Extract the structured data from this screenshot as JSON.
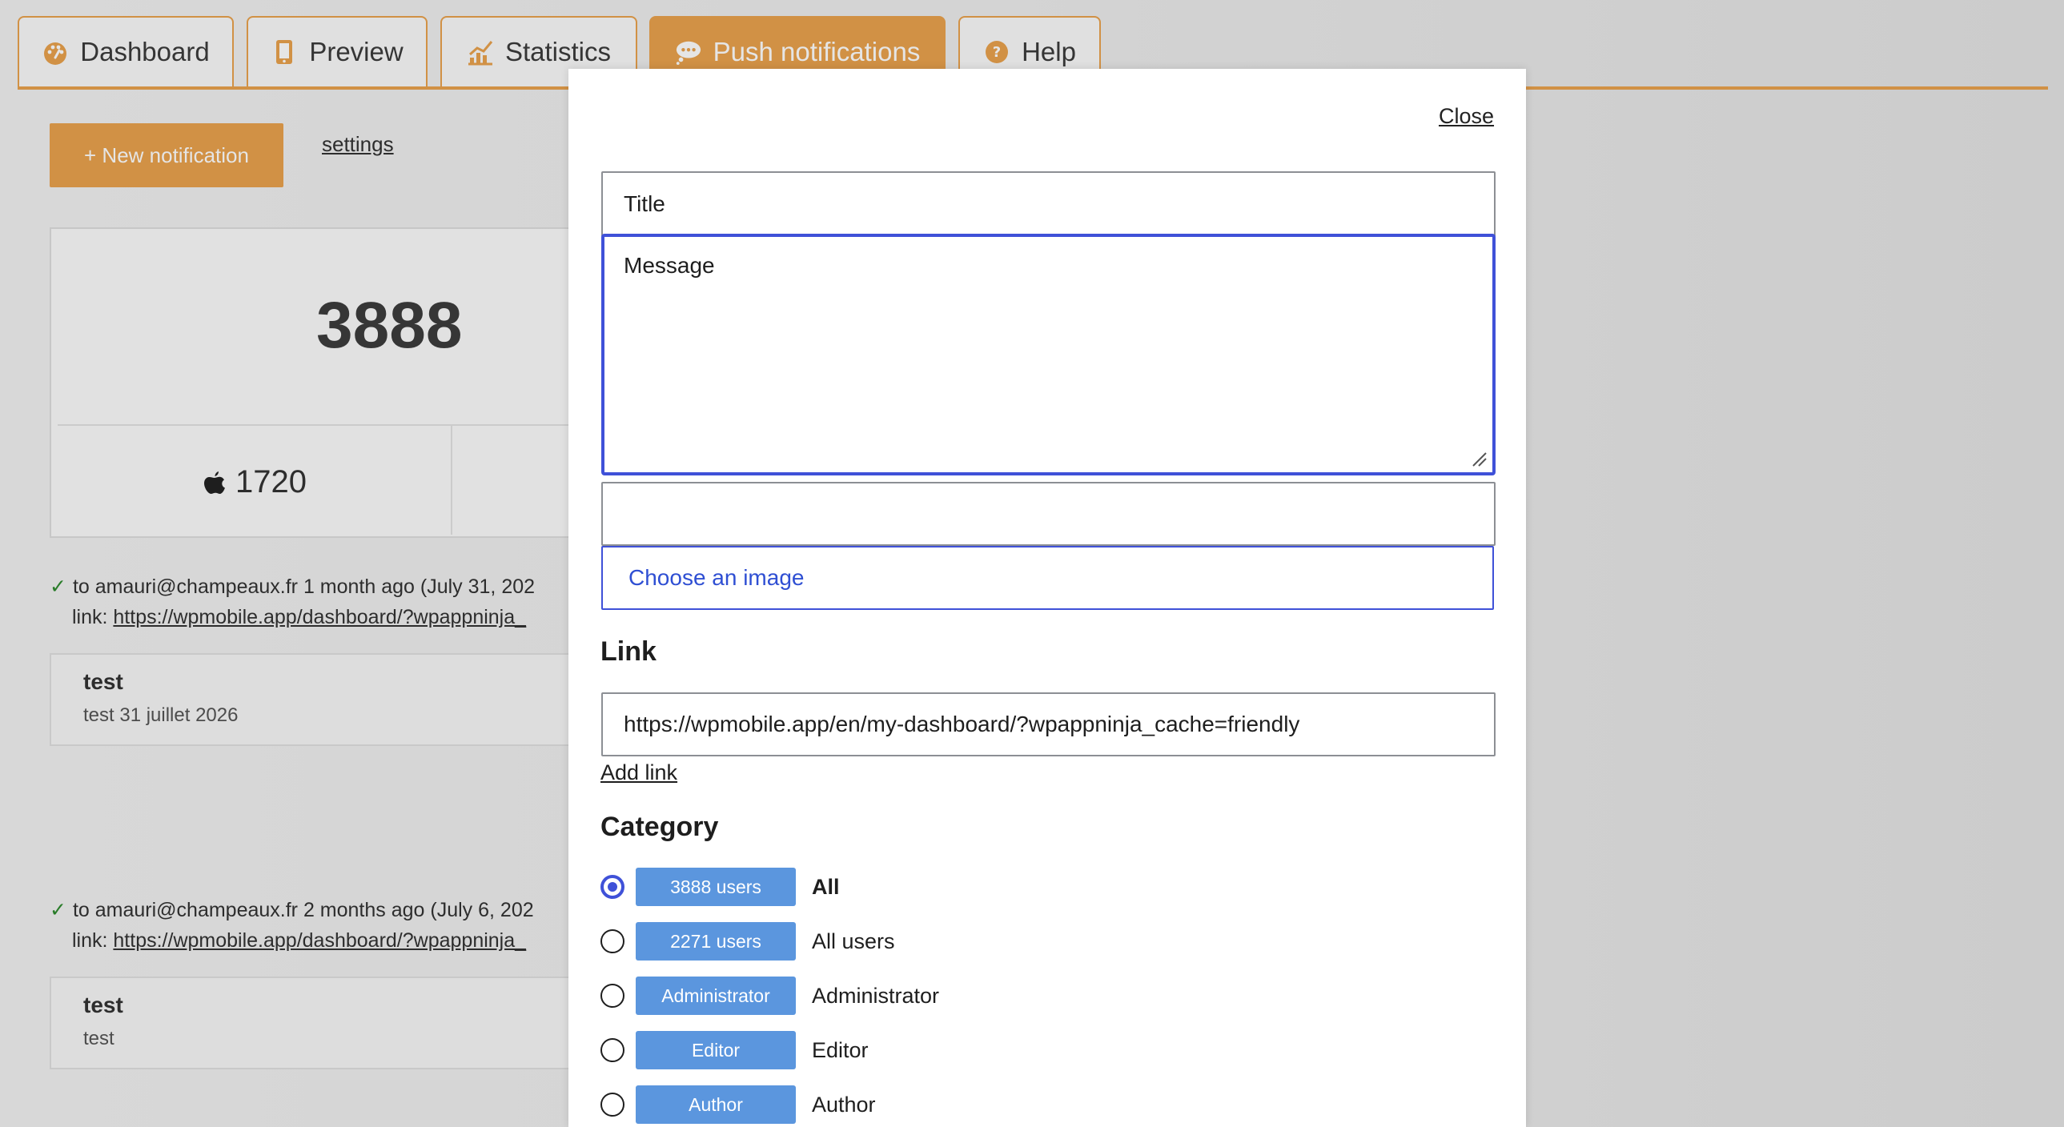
{
  "tabs": [
    {
      "label": "Dashboard",
      "icon": "dashboard-icon"
    },
    {
      "label": "Preview",
      "icon": "phone-icon"
    },
    {
      "label": "Statistics",
      "icon": "chart-icon"
    },
    {
      "label": "Push notifications",
      "icon": "chat-bubble-icon"
    },
    {
      "label": "Help",
      "icon": "question-icon"
    }
  ],
  "active_tab": "Push notifications",
  "colors": {
    "accent": "#e9a24d",
    "focus": "#3f51d8",
    "badge": "#5b96de"
  },
  "background": {
    "new_button": "+ New notification",
    "settings": "settings",
    "stats": {
      "total": "3888",
      "ios": "1720"
    },
    "notifications": [
      {
        "line1": "to amauri@champeaux.fr 1 month ago (July 31, 202",
        "link_prefix": "link: ",
        "link": "https://wpmobile.app/dashboard/?wpappninja_",
        "title": "test",
        "subtitle": "test 31 juillet 2026"
      },
      {
        "line1": "to amauri@champeaux.fr 2 months ago (July 6, 202",
        "link_prefix": "link: ",
        "link": "https://wpmobile.app/dashboard/?wpappninja_",
        "title": "test",
        "subtitle": "test"
      }
    ]
  },
  "modal": {
    "close": "Close",
    "title_placeholder": "Title",
    "message_placeholder": "Message",
    "image_value": "",
    "choose_image": "Choose an image",
    "link_heading": "Link",
    "link_value": "https://wpmobile.app/en/my-dashboard/?wpappninja_cache=friendly",
    "add_link": "Add link",
    "category_heading": "Category",
    "categories": [
      {
        "badge": "3888 users",
        "label": "All",
        "checked": true
      },
      {
        "badge": "2271 users",
        "label": "All users",
        "checked": false
      },
      {
        "badge": "Administrator",
        "label": "Administrator",
        "checked": false
      },
      {
        "badge": "Editor",
        "label": "Editor",
        "checked": false
      },
      {
        "badge": "Author",
        "label": "Author",
        "checked": false
      }
    ]
  }
}
